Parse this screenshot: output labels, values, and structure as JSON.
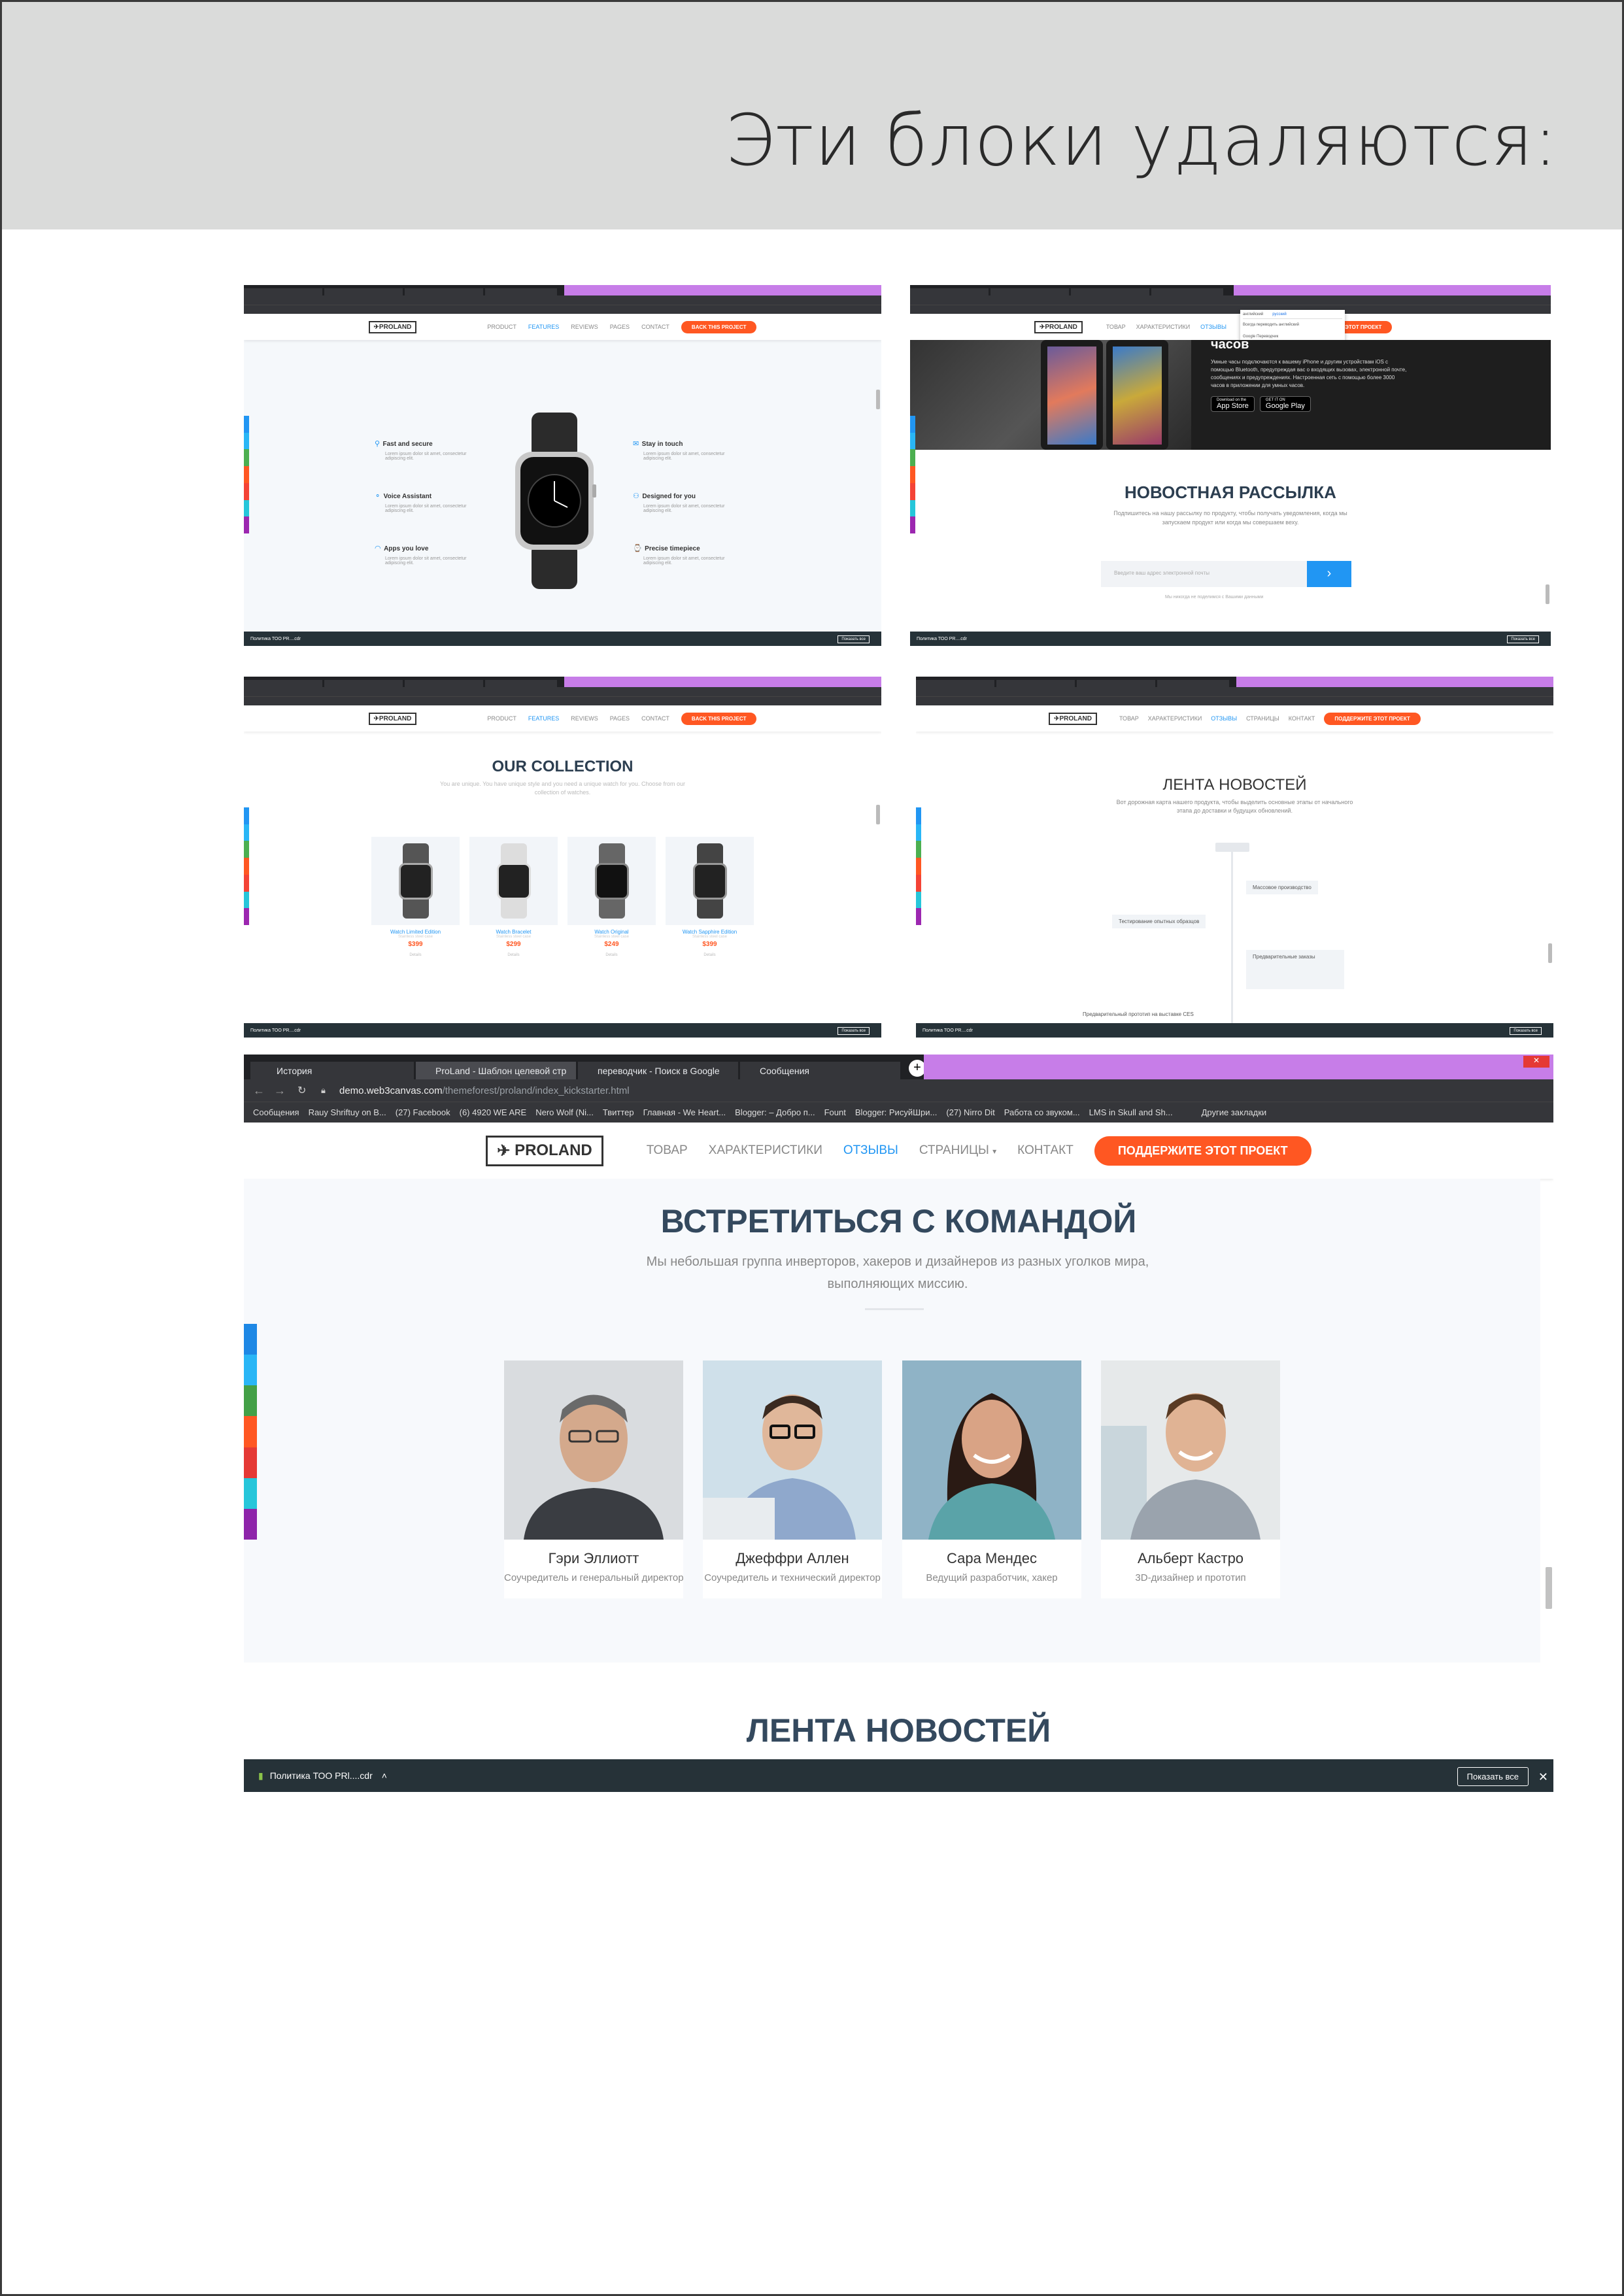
{
  "heading": "Эти блоки удаляются:",
  "colors": {
    "accent": "#ff5722",
    "blue": "#2196f3",
    "dark": "#263238",
    "purple": "#c77de8"
  },
  "shots": {
    "s1": {
      "nav": [
        "PRODUCT",
        "FEATURES",
        "REVIEWS",
        "PAGES",
        "CONTACT"
      ],
      "cta": "BACK THIS PROJECT",
      "logo": "PROLAND",
      "features_left": [
        {
          "title": "Fast and secure",
          "text": "Lorem ipsum dolor sit amet, consectetur adipiscing elit."
        },
        {
          "title": "Voice Assistant",
          "text": "Lorem ipsum dolor sit amet, consectetur adipiscing elit."
        },
        {
          "title": "Apps you love",
          "text": "Lorem ipsum dolor sit amet, consectetur adipiscing elit."
        }
      ],
      "features_right": [
        {
          "title": "Stay in touch",
          "text": "Lorem ipsum dolor sit amet, consectetur adipiscing elit."
        },
        {
          "title": "Designed for you",
          "text": "Lorem ipsum dolor sit amet, consectetur adipiscing elit."
        },
        {
          "title": "Precise timepiece",
          "text": "Lorem ipsum dolor sit amet, consectetur adipiscing elit."
        }
      ],
      "download": "Политика ТОО PR....cdr",
      "showall": "Показать все"
    },
    "s2": {
      "nav": [
        "ТОВАР",
        "ХАРАКТЕРИСТИКИ",
        "ОТЗЫВЫ"
      ],
      "cta": "ПОДДЕРЖИТЕ ЭТОТ ПРОЕКТ",
      "logo": "PROLAND",
      "hero_title": "часов",
      "hero_text": "Умные часы подключаются к вашему iPhone и другим устройствам iOS с помощью Bluetooth, предупреждая вас о входящих вызовах, электронной почте, сообщениях и предупреждениях. Настроенная сеть с помощью более 3000 часов в приложении для умных часов.",
      "app_store_small": "Download on the",
      "app_store": "App Store",
      "google_play_small": "GET IT ON",
      "google_play": "Google Play",
      "title": "НОВОСТНАЯ РАССЫЛКА",
      "text": "Подпишитесь на нашу рассылку по продукту, чтобы получать уведомления, когда мы запускаем продукт или когда мы совершаем веху.",
      "placeholder": "Введите ваш адрес электронной почты",
      "note": "Мы никогда не поделимся с Вашими данными",
      "translate_tabs": [
        "английский",
        "русский"
      ],
      "translate_items": [
        "Всегда переводить английский",
        "Google Переводчик"
      ],
      "download": "Политика ТОО PR....cdr",
      "showall": "Показать все"
    },
    "s3": {
      "nav": [
        "PRODUCT",
        "FEATURES",
        "REVIEWS",
        "PAGES",
        "CONTACT"
      ],
      "cta": "BACK THIS PROJECT",
      "logo": "PROLAND",
      "title": "OUR COLLECTION",
      "text": "You are unique. You have unique style and you need a unique watch for you. Choose from our collection of watches.",
      "products": [
        {
          "name": "Watch Limited Edition",
          "sub": "Stainless steel case",
          "price": "$399",
          "btn": "Details"
        },
        {
          "name": "Watch Bracelet",
          "sub": "Stainless steel case",
          "price": "$299",
          "btn": "Details"
        },
        {
          "name": "Watch Original",
          "sub": "Stainless steel case",
          "price": "$249",
          "btn": "Details"
        },
        {
          "name": "Watch Sapphire Edition",
          "sub": "Stainless steel case",
          "price": "$399",
          "btn": "Details"
        }
      ],
      "download": "Политика ТОО PR....cdr",
      "showall": "Показать все"
    },
    "s4": {
      "nav": [
        "ТОВАР",
        "ХАРАКТЕРИСТИКИ",
        "ОТЗЫВЫ",
        "СТРАНИЦЫ",
        "КОНТАКТ"
      ],
      "cta": "ПОДДЕРЖИТЕ ЭТОТ ПРОЕКТ",
      "logo": "PROLAND",
      "title": "ЛЕНТА НОВОСТЕЙ",
      "text": "Вот дорожная карта нашего продукта, чтобы выделить основные этапы от начального этапа до доставки и будущих обновлений.",
      "events": [
        "Массовое производство",
        "Тестирование опытных образцов",
        "Предварительные заказы",
        "Предварительный прототип на выставке CES"
      ],
      "download": "Политика ТОО PR....cdr",
      "showall": "Показать все"
    },
    "s5": {
      "tabs": [
        "История",
        "ProLand - Шаблон целевой стр",
        "переводчик - Поиск в Google",
        "Сообщения"
      ],
      "url_host": "demo.web3canvas.com",
      "url_path": "/themeforest/proland/index_kickstarter.html",
      "bookmarks": [
        "Сообщения",
        "Rauy Shriftuy on B...",
        "(27) Facebook",
        "(6) 4920 WE ARE",
        "Nero Wolf (Ni...",
        "Твиттер",
        "Главная - We Heart...",
        "Blogger: – Добро п...",
        "Fount",
        "Blogger: РисуйШри...",
        "(27) Nirro Dit",
        "Работа со звуком...",
        "LMS in Skull and Sh...",
        "Другие закладки"
      ],
      "logo": "PROLAND",
      "nav": [
        "ТОВАР",
        "ХАРАКТЕРИСТИКИ",
        "ОТЗЫВЫ",
        "СТРАНИЦЫ",
        "КОНТАКТ"
      ],
      "cta": "ПОДДЕРЖИТЕ ЭТОТ ПРОЕКТ",
      "title": "ВСТРЕТИТЬСЯ С КОМАНДОЙ",
      "text": "Мы небольшая группа инверторов, хакеров и дизайнеров из разных уголков мира, выполняющих миссию.",
      "team": [
        {
          "name": "Гэри Эллиотт",
          "role": "Соучредитель и генеральный директор"
        },
        {
          "name": "Джеффри Аллен",
          "role": "Соучредитель и технический директор"
        },
        {
          "name": "Сара Мендес",
          "role": "Ведущий разработчик, хакер"
        },
        {
          "name": "Альберт Кастро",
          "role": "3D-дизайнер и прототип"
        }
      ],
      "next_title": "ЛЕНТА НОВОСТЕЙ",
      "download": "Политика ТОО PRl....cdr",
      "showall": "Показать все"
    }
  }
}
